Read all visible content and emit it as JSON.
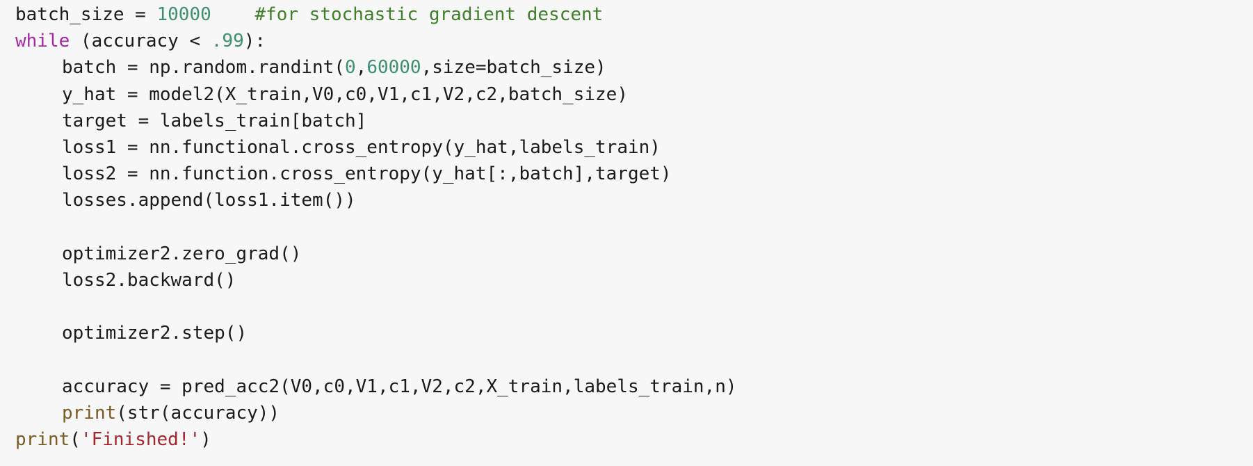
{
  "code": {
    "language": "python",
    "lines": [
      {
        "id": "l1",
        "tokens": [
          {
            "t": "batch_size = ",
            "k": "plain"
          },
          {
            "t": "10000",
            "k": "num"
          },
          {
            "t": "    ",
            "k": "plain"
          },
          {
            "t": "#for stochastic gradient descent",
            "k": "comment"
          }
        ]
      },
      {
        "id": "l2",
        "tokens": [
          {
            "t": "while",
            "k": "kw"
          },
          {
            "t": " (accuracy < ",
            "k": "plain"
          },
          {
            "t": ".99",
            "k": "num"
          },
          {
            "t": "):",
            "k": "plain"
          }
        ]
      },
      {
        "id": "l3",
        "indent": 1,
        "tokens": [
          {
            "t": "batch = np.random.randint(",
            "k": "plain"
          },
          {
            "t": "0",
            "k": "num"
          },
          {
            "t": ",",
            "k": "plain"
          },
          {
            "t": "60000",
            "k": "num"
          },
          {
            "t": ",size=batch_size)",
            "k": "plain"
          }
        ]
      },
      {
        "id": "l4",
        "indent": 1,
        "tokens": [
          {
            "t": "y_hat = model2(X_train,V0,c0,V1,c1,V2,c2,batch_size)",
            "k": "plain"
          }
        ]
      },
      {
        "id": "l5",
        "indent": 1,
        "tokens": [
          {
            "t": "target = labels_train[batch]",
            "k": "plain"
          }
        ]
      },
      {
        "id": "l6",
        "indent": 1,
        "tokens": [
          {
            "t": "loss1 = nn.functional.cross_entropy(y_hat,labels_train)",
            "k": "plain"
          }
        ]
      },
      {
        "id": "l7",
        "indent": 1,
        "tokens": [
          {
            "t": "loss2 = nn.function.cross_entropy(y_hat[:,batch],target)",
            "k": "plain"
          }
        ]
      },
      {
        "id": "l8",
        "indent": 1,
        "tokens": [
          {
            "t": "losses.append(loss1.item())",
            "k": "plain"
          }
        ]
      },
      {
        "id": "l9",
        "tokens": []
      },
      {
        "id": "l10",
        "indent": 1,
        "tokens": [
          {
            "t": "optimizer2.zero_grad()",
            "k": "plain"
          }
        ]
      },
      {
        "id": "l11",
        "indent": 1,
        "tokens": [
          {
            "t": "loss2.backward()",
            "k": "plain"
          }
        ]
      },
      {
        "id": "l12",
        "tokens": []
      },
      {
        "id": "l13",
        "indent": 1,
        "tokens": [
          {
            "t": "optimizer2.step()",
            "k": "plain"
          }
        ]
      },
      {
        "id": "l14",
        "tokens": []
      },
      {
        "id": "l15",
        "indent": 1,
        "tokens": [
          {
            "t": "accuracy = pred_acc2(V0,c0,V1,c1,V2,c2,X_train,labels_train,n)",
            "k": "plain"
          }
        ]
      },
      {
        "id": "l16",
        "indent": 1,
        "tokens": [
          {
            "t": "print",
            "k": "builtin"
          },
          {
            "t": "(str(accuracy))",
            "k": "plain"
          }
        ]
      },
      {
        "id": "l17",
        "tokens": [
          {
            "t": "print",
            "k": "builtin"
          },
          {
            "t": "(",
            "k": "plain"
          },
          {
            "t": "'Finished!'",
            "k": "str"
          },
          {
            "t": ")",
            "k": "plain"
          }
        ]
      }
    ]
  }
}
